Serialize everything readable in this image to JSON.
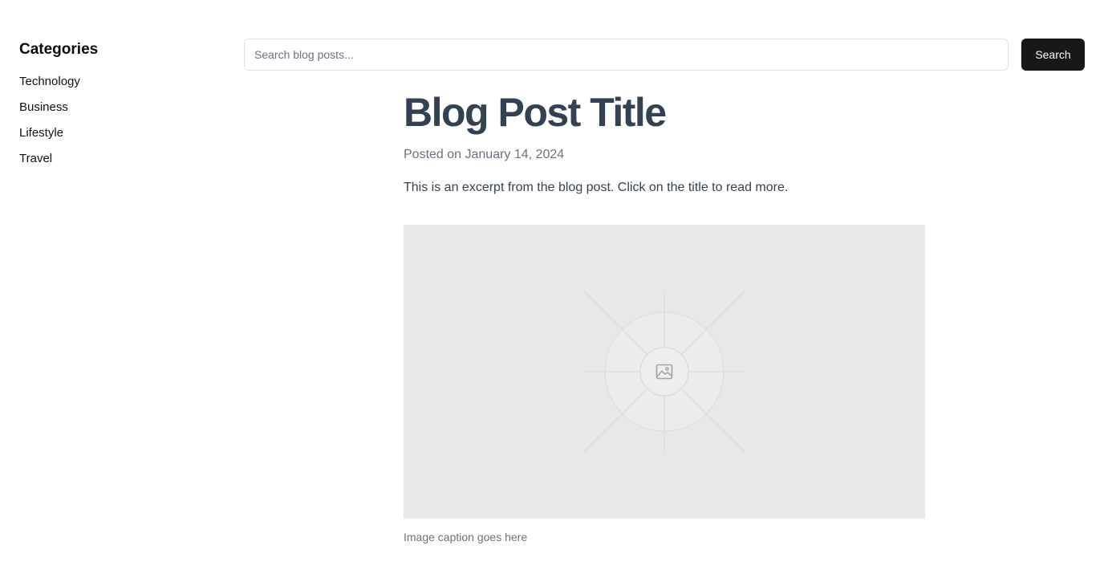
{
  "sidebar": {
    "title": "Categories",
    "items": [
      {
        "label": "Technology"
      },
      {
        "label": "Business"
      },
      {
        "label": "Lifestyle"
      },
      {
        "label": "Travel"
      }
    ]
  },
  "search": {
    "placeholder": "Search blog posts...",
    "value": "",
    "button_label": "Search"
  },
  "post": {
    "title": "Blog Post Title",
    "date": "Posted on January 14, 2024",
    "excerpt": "This is an excerpt from the blog post. Click on the title to read more.",
    "image_icon": "image-icon",
    "caption": "Image caption goes here"
  },
  "colors": {
    "button_bg": "#18181b",
    "title": "#334155",
    "muted": "#6b7280",
    "placeholder_bg": "#e8e8e8"
  }
}
